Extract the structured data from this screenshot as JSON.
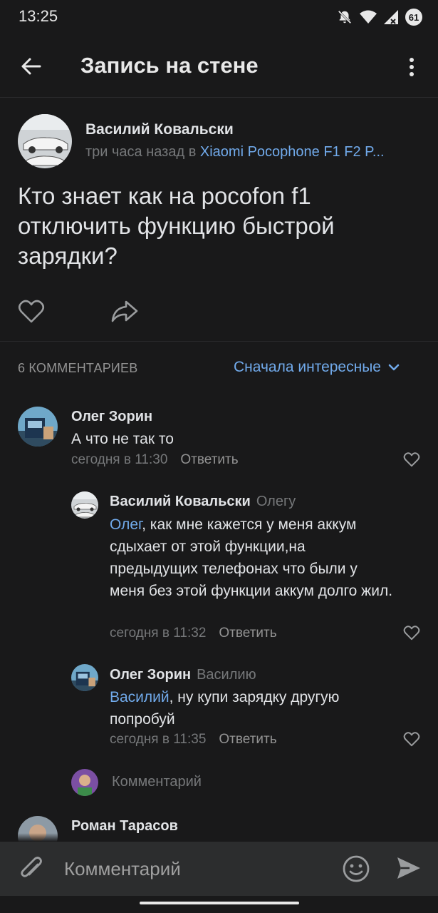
{
  "status_bar": {
    "time": "13:25",
    "battery": "61"
  },
  "app_bar": {
    "title": "Запись на стене"
  },
  "post": {
    "author": "Василий Ковальски",
    "time": "три часа назад в",
    "group": "Xiaomi Pocophone F1 F2 P...",
    "text": "Кто знает как на pocofon f1 отключить функцию быстрой зарядки?"
  },
  "comments_header": {
    "count": "6 КОММЕНТАРИЕВ",
    "sort": "Сначала интересные"
  },
  "comments": [
    {
      "author": "Олег Зорин",
      "text": "А что не так то",
      "time": "сегодня в 11:30",
      "reply": "Ответить"
    },
    {
      "author": "Василий Ковальски",
      "reply_to": "Олегу",
      "mention": "Олег",
      "text": ", как мне кажется у меня аккум сдыхает от этой функции,на предыдущих телефонах что были у меня без этой функции аккум долго жил.",
      "time": "сегодня в 11:32",
      "reply": "Ответить"
    },
    {
      "author": "Олег Зорин",
      "reply_to": "Василию",
      "mention": "Василий",
      "text": ", ну купи зарядку другую попробуй",
      "time": "сегодня в 11:35",
      "reply": "Ответить"
    },
    {
      "author": "Роман Тарасов"
    }
  ],
  "reply_input": {
    "placeholder": "Комментарий"
  },
  "bottom_input": {
    "placeholder": "Комментарий"
  },
  "colors": {
    "background": "#19191a",
    "accent": "#71aaeb",
    "secondary_text": "#76787a",
    "input_bar": "#2c2d2e"
  },
  "icons": [
    "back-arrow-icon",
    "more-vertical-icon",
    "heart-icon",
    "share-icon",
    "chevron-down-icon",
    "paperclip-icon",
    "emoji-icon",
    "send-icon",
    "mute-icon",
    "wifi-icon",
    "signal-icon",
    "battery-icon"
  ]
}
